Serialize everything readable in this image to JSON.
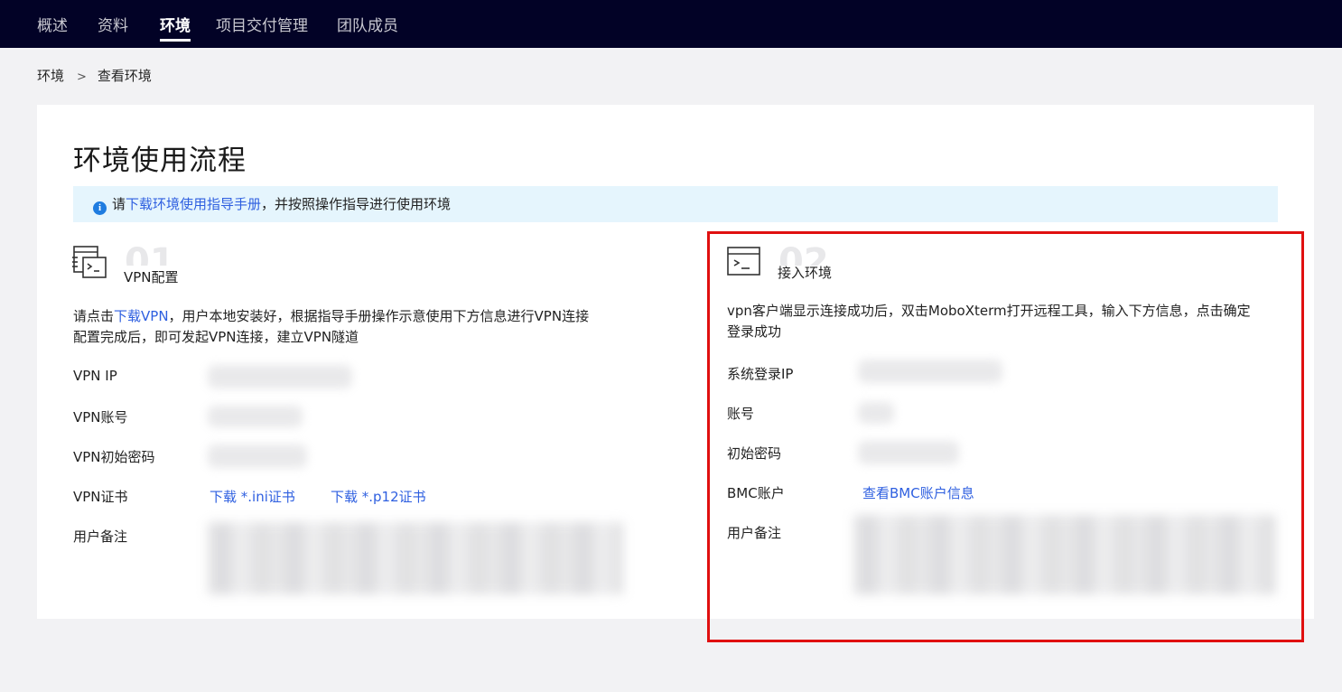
{
  "nav": {
    "items": [
      "概述",
      "资料",
      "环境",
      "项目交付管理",
      "团队成员"
    ],
    "active_index": 2
  },
  "breadcrumb": {
    "root": "环境",
    "separator": ">",
    "current": "查看环境"
  },
  "page": {
    "title": "环境使用流程"
  },
  "notice": {
    "prefix": "请",
    "link": "下载环境使用指导手册",
    "suffix": "，并按照操作指导进行使用环境"
  },
  "step1": {
    "number": "01",
    "label": "VPN配置",
    "icon": "terminal-list-icon",
    "desc_prefix": "请点击",
    "desc_link": "下载VPN",
    "desc_suffix": "，用户本地安装好，根据指导手册操作示意使用下方信息进行VPN连接",
    "desc_line2": "配置完成后，即可发起VPN连接，建立VPN隧道",
    "rows": {
      "vpn_ip": "VPN IP",
      "vpn_account": "VPN账号",
      "vpn_password": "VPN初始密码",
      "vpn_cert": "VPN证书",
      "remark": "用户备注"
    },
    "cert_links": [
      "下载 *.ini证书",
      "下载 *.p12证书"
    ]
  },
  "step2": {
    "number": "02",
    "label": "接入环境",
    "icon": "terminal-window-icon",
    "desc_line1": "vpn客户端显示连接成功后，双击MoboXterm打开远程工具，输入下方信息，点击确定",
    "desc_line2": "登录成功",
    "rows": {
      "login_ip": "系统登录IP",
      "account": "账号",
      "password": "初始密码",
      "bmc": "BMC账户",
      "remark": "用户备注"
    },
    "bmc_link": "查看BMC账户信息"
  },
  "colors": {
    "nav_bg": "#020226",
    "link": "#2e5fe0",
    "notice_bg": "#e5f5fd",
    "highlight_border": "#e01010"
  }
}
